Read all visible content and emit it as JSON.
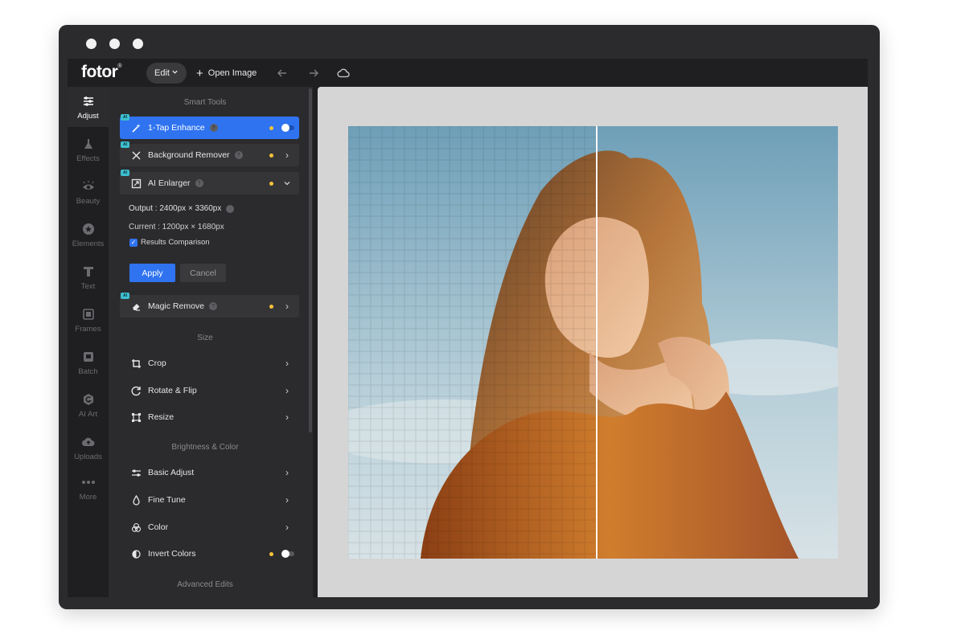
{
  "app": {
    "logo_text": "fotor",
    "logo_mark": "®",
    "edit_label": "Edit",
    "open_image_label": "Open Image",
    "nav_icons": [
      "undo-arrow-icon",
      "redo-arrow-icon",
      "cloud-icon"
    ]
  },
  "rail": {
    "items": [
      {
        "label": "Adjust",
        "icon": "sliders-icon",
        "active": true
      },
      {
        "label": "Effects",
        "icon": "flask-icon"
      },
      {
        "label": "Beauty",
        "icon": "eye-icon"
      },
      {
        "label": "Elements",
        "icon": "star-circle-icon"
      },
      {
        "label": "Text",
        "icon": "text-t-icon"
      },
      {
        "label": "Frames",
        "icon": "frame-icon"
      },
      {
        "label": "Batch",
        "icon": "batch-icon"
      },
      {
        "label": "AI Art",
        "icon": "ai-art-icon"
      },
      {
        "label": "Uploads",
        "icon": "cloud-upload-icon"
      },
      {
        "label": "More",
        "icon": "ellipsis-icon"
      }
    ]
  },
  "panel": {
    "smart_tools_title": "Smart Tools",
    "one_tap": "1-Tap Enhance",
    "background_remover": "Background Remover",
    "ai_enlarger": "AI Enlarger",
    "output": "Output : 2400px × 3360px",
    "current": "Current : 1200px × 1680px",
    "results_comparison": "Results Comparison",
    "apply": "Apply",
    "cancel": "Cancel",
    "magic_remove": "Magic Remove",
    "size_title": "Size",
    "crop": "Crop",
    "rotate_flip": "Rotate & Flip",
    "resize": "Resize",
    "brightness_title": "Brightness & Color",
    "basic_adjust": "Basic Adjust",
    "fine_tune": "Fine Tune",
    "color": "Color",
    "invert_colors": "Invert Colors",
    "advanced_title": "Advanced Edits",
    "ai_badge": "AI"
  },
  "colors": {
    "accent": "#2f73f0",
    "status_dot": "#f5c33a",
    "ai_badge": "#3dbfd0"
  }
}
